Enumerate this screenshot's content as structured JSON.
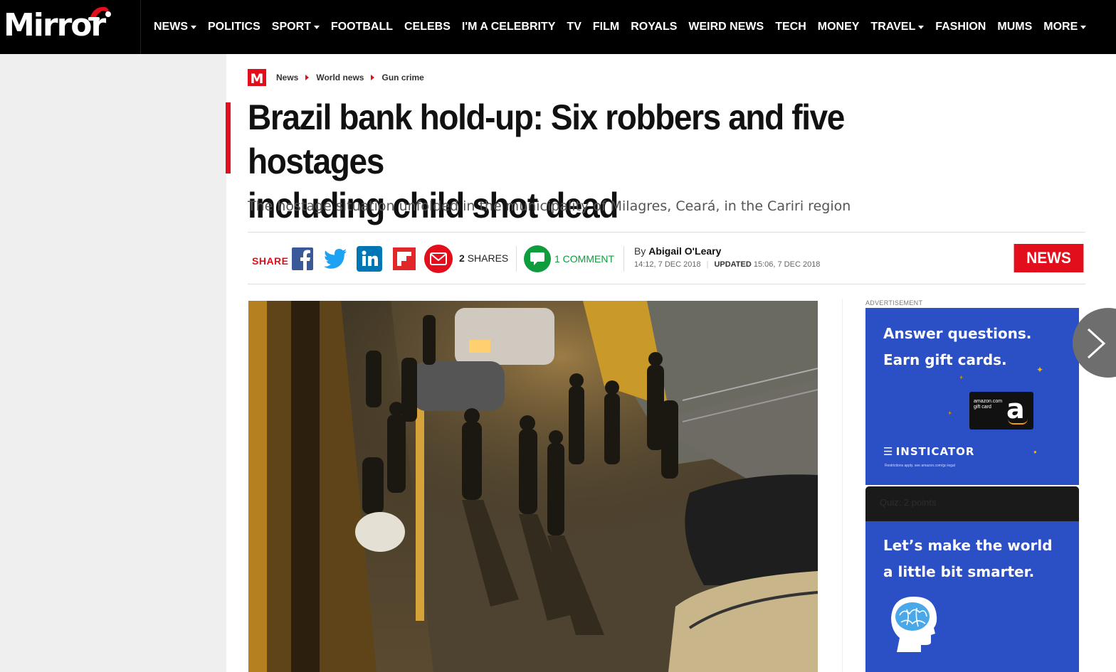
{
  "site": {
    "logo_text": "Mirror"
  },
  "nav": {
    "items": [
      {
        "label": "NEWS",
        "dropdown": true
      },
      {
        "label": "POLITICS",
        "dropdown": false
      },
      {
        "label": "SPORT",
        "dropdown": true
      },
      {
        "label": "FOOTBALL",
        "dropdown": false
      },
      {
        "label": "CELEBS",
        "dropdown": false
      },
      {
        "label": "I'M A CELEBRITY",
        "dropdown": false
      },
      {
        "label": "TV",
        "dropdown": false
      },
      {
        "label": "FILM",
        "dropdown": false
      },
      {
        "label": "ROYALS",
        "dropdown": false
      },
      {
        "label": "WEIRD NEWS",
        "dropdown": false
      },
      {
        "label": "TECH",
        "dropdown": false
      },
      {
        "label": "MONEY",
        "dropdown": false
      },
      {
        "label": "TRAVEL",
        "dropdown": true
      },
      {
        "label": "FASHION",
        "dropdown": false
      },
      {
        "label": "MUMS",
        "dropdown": false
      },
      {
        "label": "MORE",
        "dropdown": true
      }
    ]
  },
  "breadcrumb": {
    "logo": "M",
    "items": [
      "News",
      "World news",
      "Gun crime"
    ]
  },
  "article": {
    "headline_line1": "Brazil bank hold-up: Six robbers and five hostages",
    "headline_line2": "including child shot dead",
    "standfirst": "The hostage situation unfolded in the municipality of Milagres, Ceará, in the Cariri region",
    "share_label": "SHARE",
    "shares_count": "2",
    "shares_word": "SHARES",
    "comments": "1 COMMENT",
    "by_prefix": "By",
    "author": "Abigail O'Leary",
    "published": "14:12, 7 DEC 2018",
    "updated_label": "UPDATED",
    "updated": "15:06, 7 DEC 2018",
    "section_badge": "NEWS"
  },
  "sidebar": {
    "ad_label": "ADVERTISEMENT",
    "ad1": {
      "line1": "Answer questions.",
      "line2": "Earn gift cards.",
      "card_text_1": "amazon.com",
      "card_text_2": "gift card",
      "card_letter": "a",
      "brand": "INSTICATOR",
      "fine_print": "Restrictions apply. see amazon.com/gc-legal"
    },
    "ad2": {
      "top_label": "Quiz: 2 points",
      "line1": "Let’s make the world",
      "line2": "a little bit smarter."
    }
  },
  "colors": {
    "brand_red": "#e20e1b",
    "comment_green": "#0e9c3d",
    "ad_blue": "#2b4fc4"
  }
}
